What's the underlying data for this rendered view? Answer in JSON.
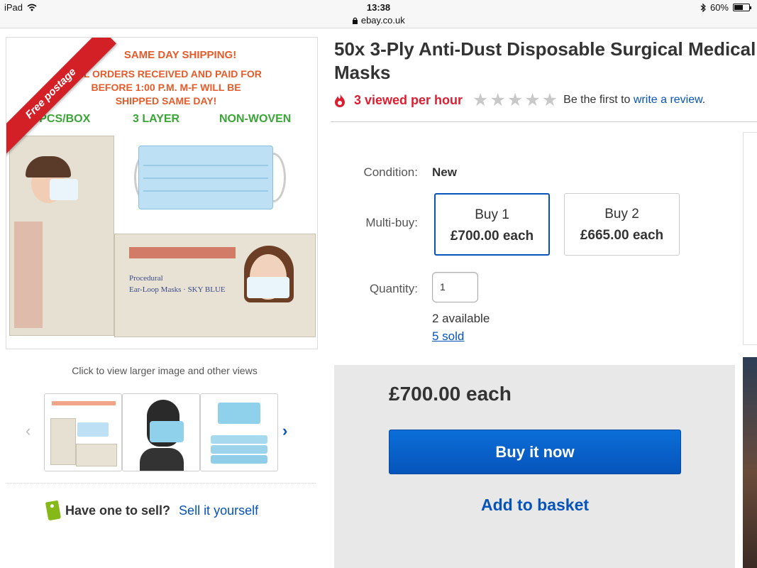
{
  "status_bar": {
    "device": "iPad",
    "time": "13:38",
    "url": "ebay.co.uk",
    "battery_percent_text": "60%",
    "battery_level": 0.6
  },
  "product_image": {
    "ribbon": "Free postage",
    "promo_title": "SAME DAY SHIPPING!",
    "promo_lines": [
      "ALL ORDERS RECEIVED AND PAID FOR",
      "BEFORE 1:00 P.M. M-F WILL BE",
      "SHIPPED SAME DAY!"
    ],
    "features": [
      "50 PCS/BOX",
      "3 LAYER",
      "NON-WOVEN"
    ]
  },
  "gallery": {
    "caption": "Click to view larger image and other views",
    "prev_arrow": "‹",
    "next_arrow": "›"
  },
  "sell": {
    "question": "Have one to sell?",
    "link": "Sell it yourself"
  },
  "listing": {
    "title_line1": "50x 3-Ply Anti-Dust Disposable Surgical Medical",
    "title_line2": "Masks",
    "viewed": "3 viewed per hour",
    "rating_stars": 0,
    "review_prefix": "Be the first to",
    "review_link": "write a review",
    "review_suffix": "."
  },
  "details": {
    "condition_label": "Condition:",
    "condition_value": "New",
    "multibuy_label": "Multi-buy:",
    "multibuy_options": [
      {
        "line1": "Buy 1",
        "line2": "£700.00 each"
      },
      {
        "line1": "Buy 2",
        "line2": "£665.00 each"
      }
    ],
    "quantity_label": "Quantity:",
    "quantity_value": "1",
    "available": "2 available",
    "sold": "5 sold"
  },
  "purchase": {
    "price": "£700.00 each",
    "buy_now": "Buy it now",
    "add_to_basket": "Add to basket"
  },
  "colors": {
    "ebay_blue": "#0654ba",
    "viewed_red": "#dd1e31",
    "ribbon_red": "#d32027",
    "feature_green": "#3aa636",
    "promo_orange": "#e55b2a"
  }
}
